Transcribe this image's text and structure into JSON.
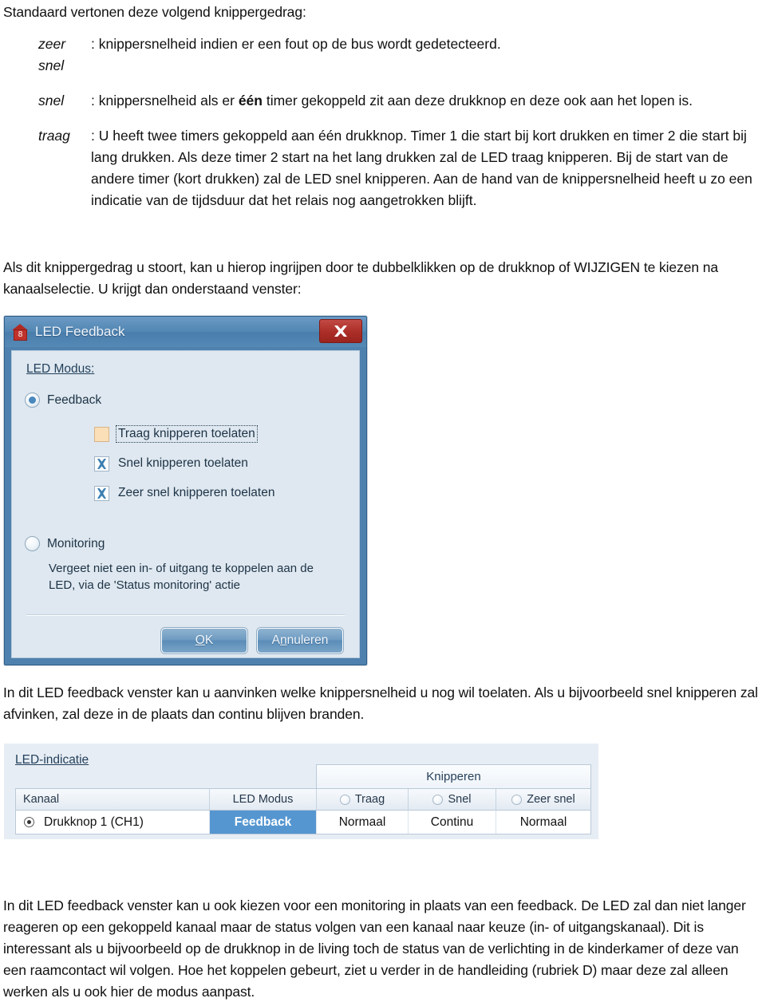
{
  "document": {
    "intro": "Standaard vertonen deze volgend knippergedrag:",
    "definitions": [
      {
        "term": "zeer snel",
        "text": ": knippersnelheid indien er een fout op de bus wordt gedetecteerd."
      },
      {
        "term": "snel",
        "text_before": ": knippersnelheid als er ",
        "bold": "één",
        "text_after": " timer gekoppeld zit aan deze drukknop en deze ook aan het lopen is."
      },
      {
        "term": "traag",
        "text": ": U heeft twee timers gekoppeld aan één drukknop. Timer 1 die start bij kort drukken en timer 2 die start bij lang drukken. Als deze timer 2 start na het lang drukken zal de LED traag knipperen. Bij de start van de andere timer (kort drukken) zal de LED snel knipperen. Aan de hand van de knippersnelheid heeft u zo een indicatie van de tijdsduur dat het relais nog aangetrokken blijft."
      }
    ],
    "para_wijzigen": "Als dit knippergedrag u stoort, kan u hierop ingrijpen door te dubbelklikken op de drukknop of WIJZIGEN te kiezen na kanaalselectie. U krijgt dan onderstaand venster:",
    "para_aanvinken": "In dit LED feedback venster kan u aanvinken welke knippersnelheid u nog wil toelaten. Als u bijvoorbeeld snel knipperen zal afvinken, zal deze in de plaats dan continu blijven branden.",
    "para_monitoring": "In dit LED feedback venster kan u ook kiezen voor een monitoring in plaats van een feedback. De LED zal dan niet langer reageren op een gekoppeld kanaal maar de status volgen van een kanaal naar keuze (in- of uitgangskanaal). Dit is interessant als u bijvoorbeeld op de drukknop in de living toch de status van de verlichting in de kinderkamer of deze van een raamcontact wil volgen. Hoe het koppelen gebeurt, ziet u verder in de handleiding (rubriek D) maar deze zal alleen werken als u ook hier de modus aanpast."
  },
  "dialog": {
    "title": "LED Feedback",
    "icon_badge": "8",
    "close_tooltip": "Sluiten",
    "group_label": "LED Modus:",
    "radios": [
      {
        "label": "Feedback",
        "checked": true
      },
      {
        "label": "Monitoring",
        "checked": false
      }
    ],
    "checkboxes": [
      {
        "label": "Traag knipperen toelaten",
        "checked": false,
        "focused": true
      },
      {
        "label": "Snel knipperen toelaten",
        "checked": true,
        "focused": false
      },
      {
        "label": "Zeer snel knipperen toelaten",
        "checked": true,
        "focused": false
      }
    ],
    "monitoring_note": "Vergeet niet een in- of uitgang te koppelen aan de LED, via de 'Status monitoring' actie",
    "buttons": {
      "ok": {
        "prefix": "",
        "mnemonic": "O",
        "suffix": "K"
      },
      "cancel": {
        "prefix": "A",
        "mnemonic": "n",
        "suffix": "nuleren"
      }
    },
    "colors": {
      "titlebar": "#5387b4",
      "close_button": "#ab2e27",
      "body": "#dfe8f0",
      "button": "#6f9cc2",
      "accent": "#4a88bd",
      "unchecked_box": "#fbdfb8"
    }
  },
  "led_table": {
    "title": "LED-indicatie",
    "group_header": "Knipperen",
    "columns": [
      {
        "label": "Kanaal",
        "has_radio": false
      },
      {
        "label": "LED Modus",
        "has_radio": false
      },
      {
        "label": "Traag",
        "has_radio": true
      },
      {
        "label": "Snel",
        "has_radio": true
      },
      {
        "label": "Zeer snel",
        "has_radio": true
      }
    ],
    "rows": [
      {
        "kanaal": "Drukknop 1 (CH1)",
        "led_modus": "Feedback",
        "traag": "Normaal",
        "snel": "Continu",
        "zeer_snel": "Normaal",
        "selected_column": "led_modus"
      }
    ],
    "colors": {
      "selection": "#5596d0",
      "header": "#e3eaf2"
    }
  }
}
